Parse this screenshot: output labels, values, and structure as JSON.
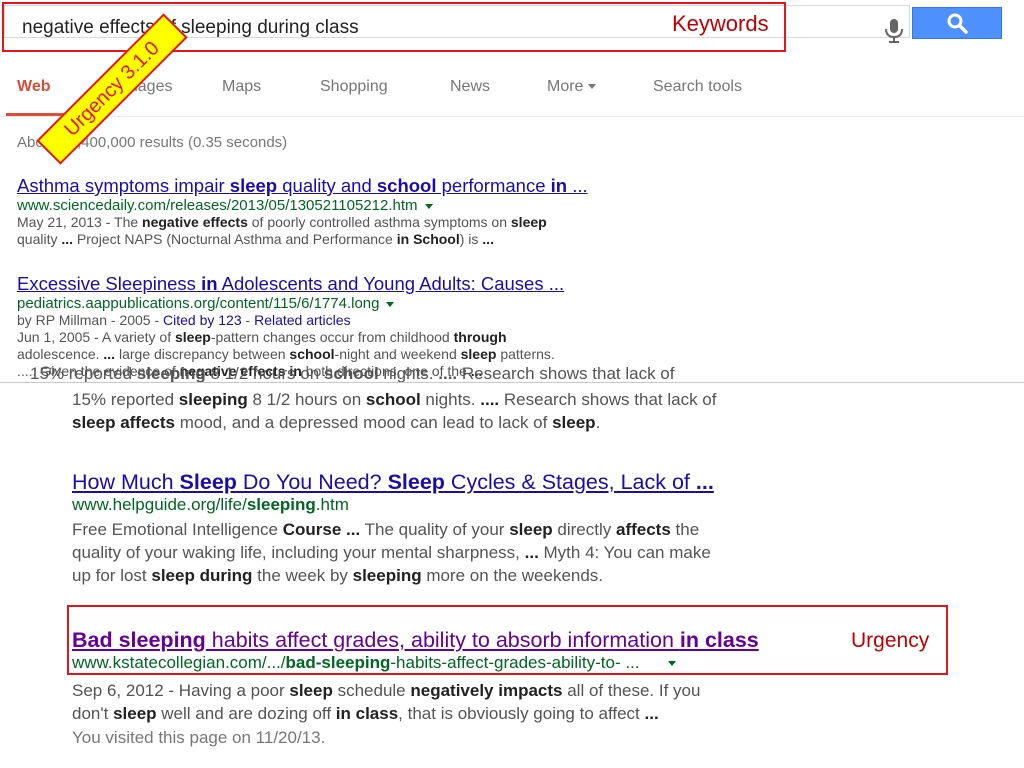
{
  "search": {
    "query": "negative effects of sleeping during class"
  },
  "tabs": [
    {
      "label": "Web"
    },
    {
      "label": "Images"
    },
    {
      "label": "Maps"
    },
    {
      "label": "Shopping"
    },
    {
      "label": "News"
    },
    {
      "label": "More"
    },
    {
      "label": "Search tools"
    }
  ],
  "result_stats": "About 26,400,000 results (0.35 seconds)",
  "results_top": [
    {
      "title_parts": [
        [
          "Asthma symptoms impair ",
          false
        ],
        [
          "sleep",
          true
        ],
        [
          " quality and ",
          false
        ],
        [
          "school",
          true
        ],
        [
          " performance ",
          false
        ],
        [
          "in",
          true
        ],
        [
          " ...",
          false
        ]
      ],
      "url": "www.sciencedaily.com/releases/2013/05/130521105212.htm",
      "snippet_lines": [
        [
          [
            "May 21, 2013 - The ",
            false
          ],
          [
            "negative effects",
            true
          ],
          [
            " of poorly controlled asthma symptoms on ",
            false
          ],
          [
            "sleep",
            true
          ]
        ],
        [
          [
            "quality ",
            false
          ],
          [
            "...",
            true
          ],
          [
            " Project NAPS (Nocturnal Asthma and Performance ",
            false
          ],
          [
            "in School",
            true
          ],
          [
            ") is ",
            false
          ],
          [
            "...",
            true
          ]
        ]
      ]
    },
    {
      "title_parts": [
        [
          "Excessive Sleepiness ",
          false
        ],
        [
          "in",
          true
        ],
        [
          " Adolescents and Young Adults: Causes ...",
          false
        ]
      ],
      "url": "pediatrics.aappublications.org/content/115/6/1774.long",
      "meta": {
        "prefix": "by RP Millman - 2005 - ",
        "cited": "Cited by 123",
        "sep": " - ",
        "related": "Related articles"
      },
      "snippet_lines": [
        [
          [
            "Jun 1, 2005 - A variety of ",
            false
          ],
          [
            "sleep",
            true
          ],
          [
            "-pattern changes occur from childhood ",
            false
          ],
          [
            "through",
            true
          ]
        ],
        [
          [
            "adolescence. ",
            false
          ],
          [
            "...",
            true
          ],
          [
            " large discrepancy between ",
            false
          ],
          [
            "school",
            true
          ],
          [
            "-night and weekend ",
            false
          ],
          [
            "sleep",
            true
          ],
          [
            " patterns.",
            false
          ]
        ],
        [
          [
            "..... Given the evidence of ",
            false
          ],
          [
            "negative effects in",
            true
          ],
          [
            " both directions, one of the ",
            false
          ],
          [
            "...",
            true
          ]
        ]
      ]
    }
  ],
  "results_bottom": [
    {
      "partial": true,
      "snippet_lines": [
        [
          [
            "15% reported ",
            false
          ],
          [
            "sleeping",
            true
          ],
          [
            " 8 1/2 hours on ",
            false
          ],
          [
            "school",
            true
          ],
          [
            " nights. ",
            false
          ],
          [
            "....",
            true
          ],
          [
            " Research shows that lack of",
            false
          ]
        ],
        [
          [
            "sleep affects",
            true
          ],
          [
            " mood, and a depressed mood can lead to lack of ",
            false
          ],
          [
            "sleep",
            true
          ],
          [
            ".",
            false
          ]
        ]
      ]
    },
    {
      "title_parts": [
        [
          "How Much ",
          false
        ],
        [
          "Sleep",
          true
        ],
        [
          " Do You Need? ",
          false
        ],
        [
          "Sleep",
          true
        ],
        [
          " Cycles & Stages, Lack of ",
          false
        ],
        [
          "...",
          true
        ]
      ],
      "url_parts": [
        [
          "www.helpguide.org/life/",
          false
        ],
        [
          "sleeping",
          true
        ],
        [
          ".htm",
          false
        ]
      ],
      "snippet_lines": [
        [
          [
            "Free Emotional Intelligence ",
            false
          ],
          [
            "Course ...",
            true
          ],
          [
            " The quality of your ",
            false
          ],
          [
            "sleep",
            true
          ],
          [
            " directly ",
            false
          ],
          [
            "affects",
            true
          ],
          [
            " the",
            false
          ]
        ],
        [
          [
            "quality of your waking life, including your mental sharpness, ",
            false
          ],
          [
            "...",
            true
          ],
          [
            " Myth 4: You can make",
            false
          ]
        ],
        [
          [
            "up for lost ",
            false
          ],
          [
            "sleep during",
            true
          ],
          [
            " the week by ",
            false
          ],
          [
            "sleeping",
            true
          ],
          [
            " more on the weekends.",
            false
          ]
        ]
      ]
    },
    {
      "visited": true,
      "title_parts": [
        [
          "Bad sleeping",
          true
        ],
        [
          " habits affect grades, ability to absorb information ",
          false
        ],
        [
          "in class",
          true
        ]
      ],
      "url_parts": [
        [
          "www.kstatecollegian.com/.../",
          false
        ],
        [
          "bad-sleeping",
          true
        ],
        [
          "-habits-affect-grades-ability-to- ...",
          false
        ]
      ],
      "snippet_lines": [
        [
          [
            "Sep 6, 2012 - Having a poor ",
            false
          ],
          [
            "sleep",
            true
          ],
          [
            " schedule ",
            false
          ],
          [
            "negatively impacts",
            true
          ],
          [
            " all of these. If you",
            false
          ]
        ],
        [
          [
            "don't ",
            false
          ],
          [
            "sleep",
            true
          ],
          [
            " well and are dozing off ",
            false
          ],
          [
            "in class",
            true
          ],
          [
            ", that is obviously going to affect ",
            false
          ],
          [
            "...",
            true
          ]
        ]
      ],
      "visited_note": "You visited this page on 11/20/13."
    }
  ],
  "annotations": {
    "keywords_label": "Keywords",
    "urgency_ribbon": "Urgency 3.1.0",
    "urgency_label": "Urgency",
    "color": "#e8141c",
    "ribbon_fill": "#ffff00"
  },
  "icons": {
    "mic": "microphone-icon",
    "search": "magnifier-icon"
  },
  "colors": {
    "link": "#1a0dab",
    "visited": "#660099",
    "url": "#006621",
    "tab_active": "#dd4b39",
    "search_button": "#4d90fe"
  }
}
